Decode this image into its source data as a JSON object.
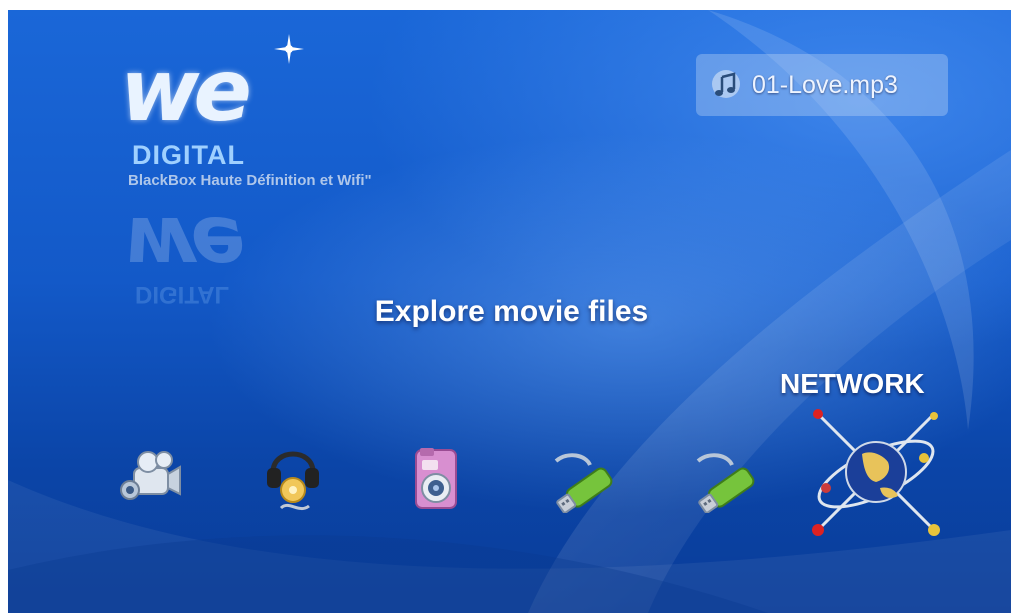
{
  "brand": {
    "logo_text": "we",
    "logo_sub": "DIGITAL",
    "tagline": "BlackBox Haute Définition et Wifi\""
  },
  "now_playing": {
    "icon": "music-note-icon",
    "title": "01-Love.mp3"
  },
  "main": {
    "section_title": "Explore movie files",
    "selected_label": "NETWORK",
    "menu_items": [
      {
        "id": "movies",
        "icon": "video-camera-icon"
      },
      {
        "id": "music",
        "icon": "headphones-icon"
      },
      {
        "id": "photos",
        "icon": "photo-camera-icon"
      },
      {
        "id": "usb1",
        "icon": "usb-icon"
      },
      {
        "id": "usb2",
        "icon": "usb-icon"
      },
      {
        "id": "network",
        "icon": "globe-network-icon",
        "selected": true
      }
    ]
  },
  "colors": {
    "background": "#1359c8",
    "text": "#ffffff",
    "logo_sub": "#9fd0ff"
  }
}
